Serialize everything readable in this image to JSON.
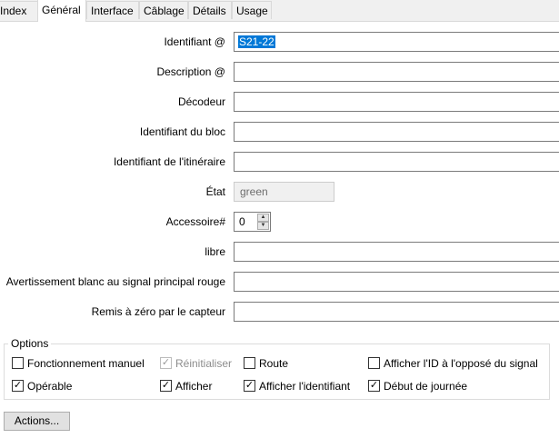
{
  "tabs": [
    "Index",
    "Général",
    "Interface",
    "Câblage",
    "Détails",
    "Usage"
  ],
  "active_tab": "Général",
  "form": {
    "identifiant_label": "Identifiant @",
    "identifiant_value": "S21-22",
    "description_label": "Description @",
    "description_value": "",
    "decodeur_label": "Décodeur",
    "decodeur_value": "",
    "bloc_label": "Identifiant du bloc",
    "bloc_value": "",
    "itineraire_label": "Identifiant de l'itinéraire",
    "itineraire_value": "",
    "etat_label": "État",
    "etat_value": "green",
    "accessoire_label": "Accessoire#",
    "accessoire_value": "0",
    "libre_label": "libre",
    "libre_value": "",
    "avertissement_label": "Avertissement blanc au signal principal rouge",
    "avertissement_value": "",
    "remis_label": "Remis à zéro par le capteur",
    "remis_value": ""
  },
  "options": {
    "title": "Options",
    "items": [
      {
        "label": "Fonctionnement manuel",
        "checked": false,
        "disabled": false
      },
      {
        "label": "Réinitialiser",
        "checked": true,
        "disabled": true
      },
      {
        "label": "Route",
        "checked": false,
        "disabled": false
      },
      {
        "label": "Afficher l'ID à l'opposé du signal",
        "checked": false,
        "disabled": false
      },
      {
        "label": "Opérable",
        "checked": true,
        "disabled": false
      },
      {
        "label": "Afficher",
        "checked": true,
        "disabled": false
      },
      {
        "label": "Afficher l'identifiant",
        "checked": true,
        "disabled": false
      },
      {
        "label": "Début de journée",
        "checked": true,
        "disabled": false
      }
    ]
  },
  "actions_label": "Actions...",
  "colors": {
    "selection": "#0078d7",
    "window_bg": "#ffffff",
    "tab_bg": "#f0f0f0"
  }
}
